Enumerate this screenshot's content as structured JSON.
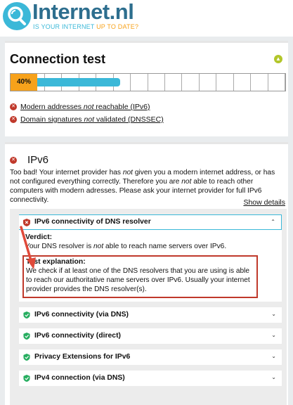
{
  "brand": {
    "name": "Internet.nl",
    "tagline_main": "IS YOUR INTERNET",
    "tagline_accent": "UP TO DATE?"
  },
  "connection_test": {
    "title": "Connection test",
    "progress_label": "40%",
    "progress_value": 0.4,
    "failures": [
      {
        "before": "Modern addresses ",
        "emph": "not",
        "after": " reachable (IPv6)"
      },
      {
        "before": "Domain signatures ",
        "emph": "not",
        "after": " validated (DNSSEC)"
      }
    ]
  },
  "ipv6": {
    "title": "IPv6",
    "intro_a": "Too bad! Your internet provider has ",
    "intro_emph1": "not",
    "intro_b": " given you a modern internet address, or has not configured everything correctly. Therefore you are ",
    "intro_emph2": "not",
    "intro_c": " able to reach other computers with modern adresses. Please ask your internet provider for full IPv6 connectivity.",
    "show_details": "Show details",
    "open_item": {
      "title": "IPv6 connectivity of DNS resolver",
      "verdict_label": "Verdict:",
      "verdict_a": "Your DNS resolver is ",
      "verdict_emph": "not",
      "verdict_b": " able to reach name servers over IPv6.",
      "explanation_label": "Test explanation:",
      "explanation_text": "We check if at least one of the DNS resolvers that you are using is able to reach our authoritative name servers over IPv6. Usually your internet provider provides the DNS resolver(s)."
    },
    "items": [
      {
        "title": "IPv6 connectivity (via DNS)"
      },
      {
        "title": "IPv6 connectivity (direct)"
      },
      {
        "title": "Privacy Extensions for IPv6"
      },
      {
        "title": "IPv4 connection (via DNS)"
      }
    ]
  },
  "colors": {
    "brand_blue": "#3bb8d8",
    "brand_dark": "#2d6e8e",
    "accent_orange": "#f7a21b",
    "fail_red": "#c0392b",
    "pass_green": "#27ae60"
  }
}
